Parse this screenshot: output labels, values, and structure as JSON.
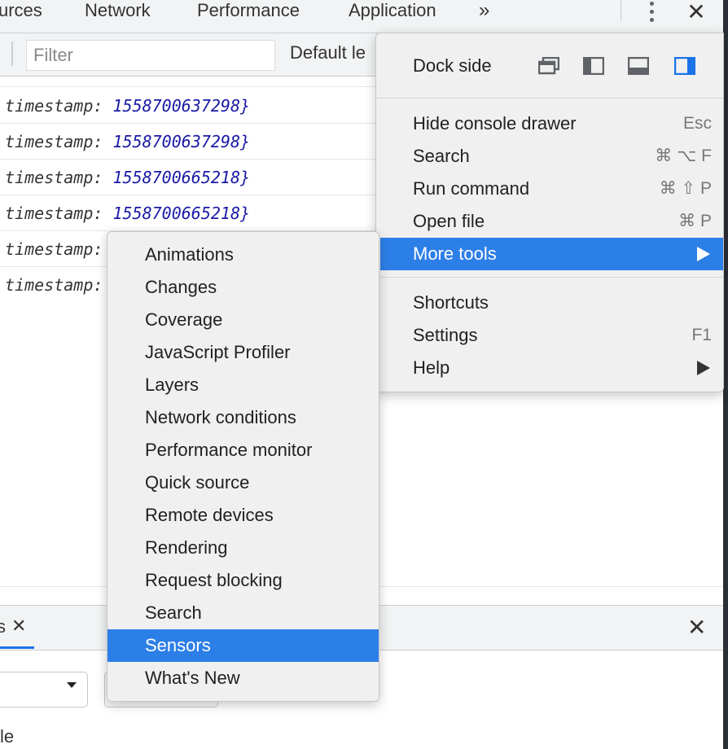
{
  "tabs": [
    "urces",
    "Network",
    "Performance",
    "Application"
  ],
  "tabs_overflow": "»",
  "toolbar": {
    "filter_placeholder": "Filter",
    "levels_label": "Default le"
  },
  "console_lines": [
    {
      "key": "timestamp:",
      "value": "1558700637298}"
    },
    {
      "key": "timestamp:",
      "value": "1558700637298}"
    },
    {
      "key": "timestamp:",
      "value": "1558700665218}"
    },
    {
      "key": "timestamp:",
      "value": "1558700665218}"
    },
    {
      "key": "timestamp:",
      "value": ""
    },
    {
      "key": "timestamp:",
      "value": ""
    }
  ],
  "main_menu": {
    "dock_side_label": "Dock side",
    "dock_icons": [
      "undock-icon",
      "dock-left-icon",
      "dock-bottom-icon",
      "dock-right-icon"
    ],
    "items": [
      {
        "label": "Hide console drawer",
        "shortcut": "Esc"
      },
      {
        "label": "Search",
        "shortcut": "⌘ ⌥ F"
      },
      {
        "label": "Run command",
        "shortcut": "⌘ ⇧ P"
      },
      {
        "label": "Open file",
        "shortcut": "⌘ P"
      },
      {
        "label": "More tools",
        "shortcut": "",
        "submenu": true,
        "active": true
      },
      {
        "label": "Shortcuts",
        "shortcut": ""
      },
      {
        "label": "Settings",
        "shortcut": "F1"
      },
      {
        "label": "Help",
        "shortcut": "",
        "submenu": true
      }
    ]
  },
  "more_tools": [
    "Animations",
    "Changes",
    "Coverage",
    "JavaScript Profiler",
    "Layers",
    "Network conditions",
    "Performance monitor",
    "Quick source",
    "Remote devices",
    "Rendering",
    "Request blocking",
    "Search",
    "Sensors",
    "What's New"
  ],
  "more_tools_active": "Sensors",
  "drawer": {
    "tab_label": "s",
    "close_glyph": "✕",
    "bottom_text": "le"
  },
  "colors": {
    "accent": "#2d7fe8",
    "number": "#1a1aa6",
    "dock_active": "#1a73e8"
  }
}
